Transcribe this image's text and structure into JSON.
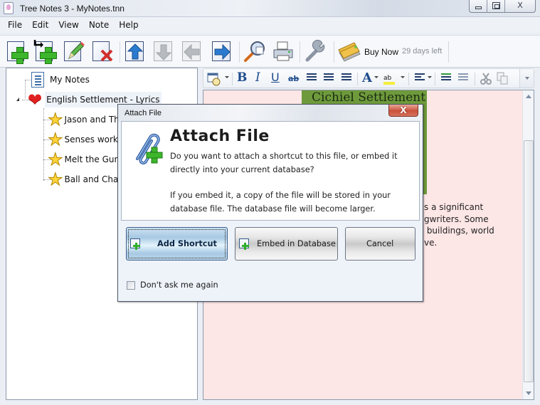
{
  "window": {
    "title": "Tree Notes 3 - MyNotes.tnn",
    "controls": {
      "minimize": "minimize",
      "maximize": "maximize",
      "close": "X"
    }
  },
  "menubar": {
    "items": [
      {
        "label": "File"
      },
      {
        "label": "Edit"
      },
      {
        "label": "View"
      },
      {
        "label": "Note"
      },
      {
        "label": "Help"
      }
    ]
  },
  "toolbar": {
    "buttons": [
      {
        "name": "new-note",
        "icon": "add-page-icon",
        "enabled": true
      },
      {
        "name": "new-child-note",
        "icon": "add-child-page-icon",
        "enabled": true
      },
      {
        "name": "edit-note",
        "icon": "pencil-icon",
        "enabled": true
      },
      {
        "name": "delete-note",
        "icon": "delete-page-icon",
        "enabled": true
      },
      {
        "name": "move-up",
        "icon": "arrow-up-icon",
        "enabled": true
      },
      {
        "name": "move-down",
        "icon": "arrow-down-icon",
        "enabled": false
      },
      {
        "name": "move-left",
        "icon": "arrow-left-icon",
        "enabled": false
      },
      {
        "name": "move-right",
        "icon": "arrow-right-icon",
        "enabled": true
      },
      {
        "name": "search",
        "icon": "magnifier-icon",
        "enabled": true
      },
      {
        "name": "print",
        "icon": "printer-icon",
        "enabled": true
      },
      {
        "name": "options",
        "icon": "wrench-icon",
        "enabled": true
      }
    ],
    "buy_now_label": "Buy Now",
    "trial_status": "29 days left"
  },
  "tree": {
    "items": [
      {
        "label": "My Notes",
        "icon": "notes-icon",
        "level": 0
      },
      {
        "label": "English Settlement  - Lyrics",
        "icon": "heart-icon",
        "level": 0,
        "expanded": true,
        "selected": true
      },
      {
        "label": "Jason and The Scorchers",
        "icon": "star-icon",
        "level": 1
      },
      {
        "label": "Senses working overtime",
        "icon": "star-icon",
        "level": 1
      },
      {
        "label": "Melt the Guns",
        "icon": "star-icon",
        "level": 1
      },
      {
        "label": "Ball and Chain",
        "icon": "star-icon",
        "level": 1
      }
    ]
  },
  "format_toolbar": {
    "items": [
      {
        "name": "insert-date",
        "icon": "calendar-clock-icon"
      },
      {
        "name": "bold",
        "glyph": "B"
      },
      {
        "name": "italic",
        "glyph": "I"
      },
      {
        "name": "underline",
        "glyph": "U"
      },
      {
        "name": "strikethrough",
        "glyph": "ab"
      },
      {
        "name": "bullet-list",
        "icon": "bullet-list-icon"
      },
      {
        "name": "numbered-list",
        "icon": "numbered-list-icon"
      },
      {
        "name": "multilevel-list",
        "icon": "multilevel-list-icon"
      },
      {
        "name": "font-color",
        "glyph": "A"
      },
      {
        "name": "highlight",
        "glyph": "ab"
      },
      {
        "name": "align",
        "icon": "align-left-icon"
      },
      {
        "name": "indent",
        "icon": "indent-icon"
      },
      {
        "name": "outdent",
        "icon": "outdent-icon"
      },
      {
        "name": "cut",
        "icon": "scissors-icon"
      },
      {
        "name": "copy",
        "icon": "copy-icon"
      }
    ]
  },
  "editor": {
    "background": "#fde6e6",
    "image_caption": "Cichiel Settlement",
    "body_lines": [
      "s a significant",
      "gwriters. Some",
      " buildings, world",
      "ve."
    ]
  },
  "dialog": {
    "title": "Attach File",
    "heading": "Attach File",
    "message_1": "Do you want to attach a shortcut to this file, or embed it directly into your current database?",
    "message_2": "If you embed it, a copy of the file will be stored in your database file. The database file will become larger.",
    "buttons": {
      "add_shortcut": "Add Shortcut",
      "embed": "Embed in Database",
      "cancel": "Cancel"
    },
    "checkbox": {
      "label": "Don't ask me again",
      "checked": false
    },
    "close_label": "X"
  }
}
